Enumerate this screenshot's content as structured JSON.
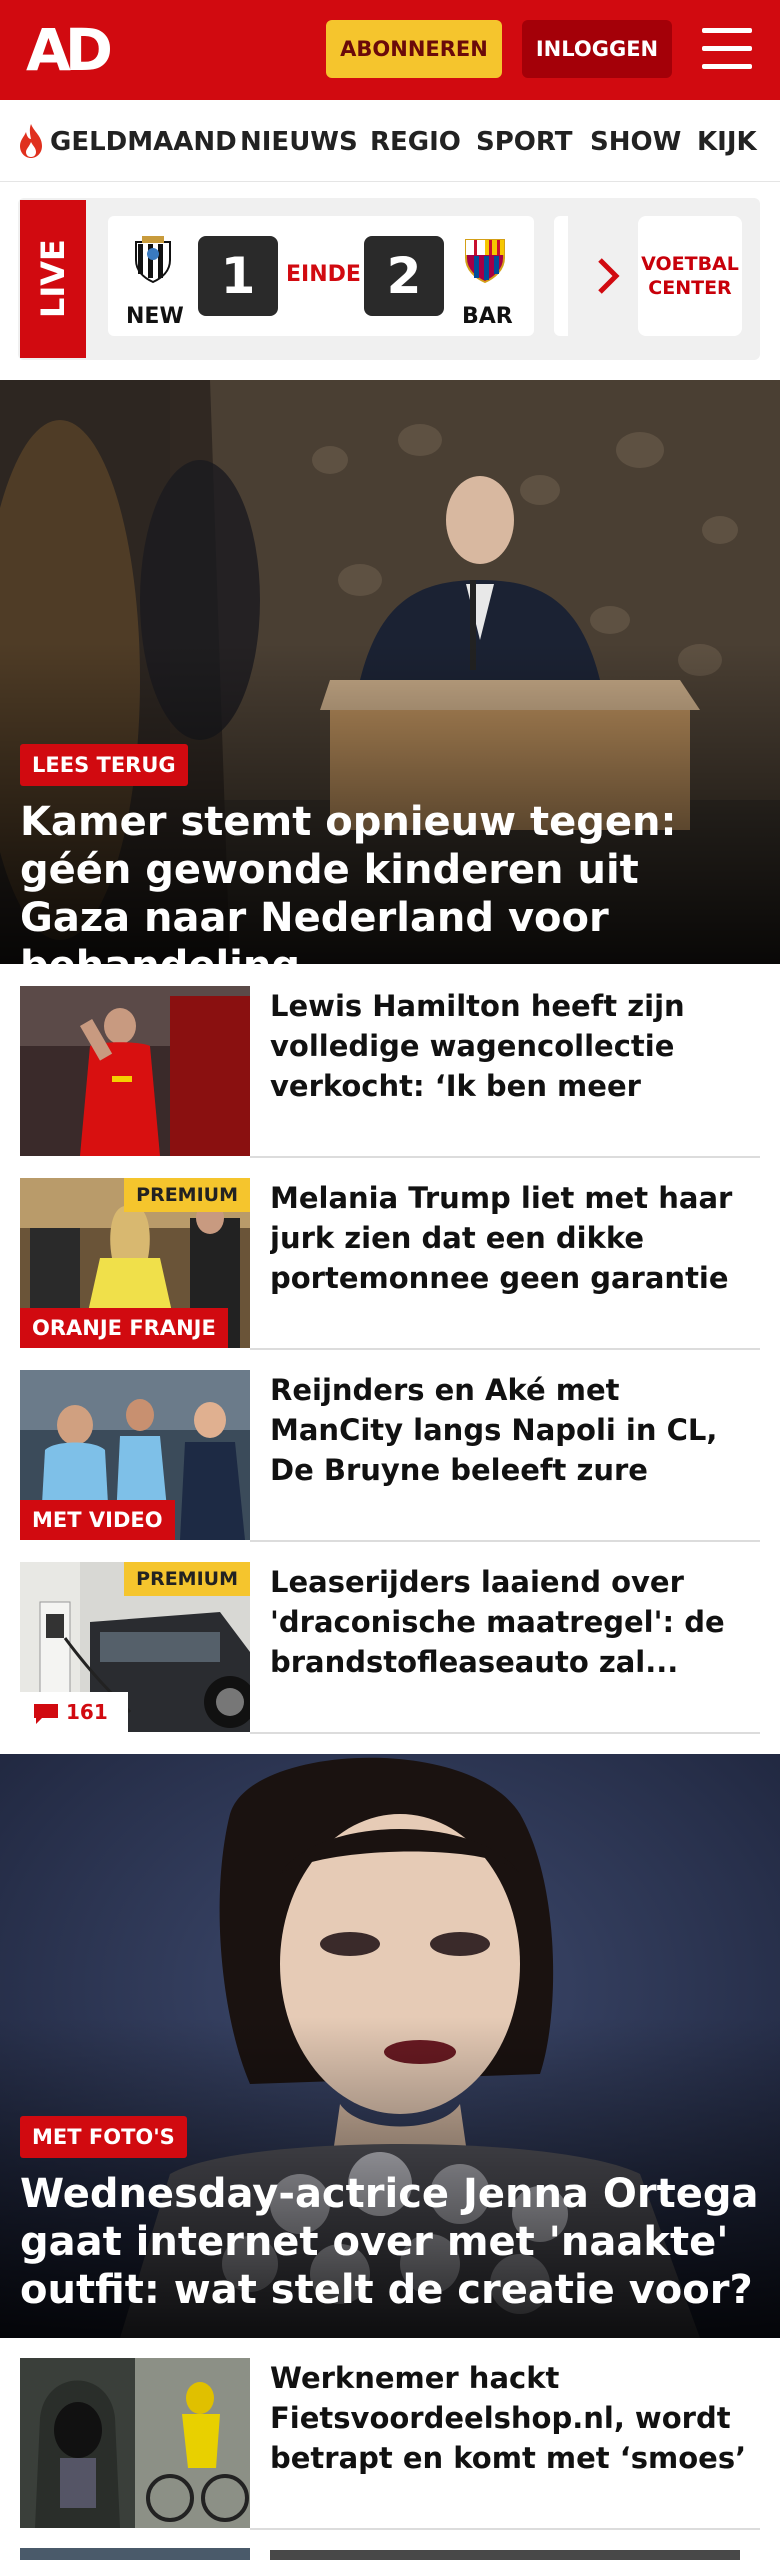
{
  "header": {
    "logo": "AD",
    "subscribe_label": "ABONNEREN",
    "login_label": "INLOGGEN"
  },
  "nav": {
    "items": [
      "GELDMAAND",
      "NIEUWS",
      "REGIO",
      "SPORT",
      "SHOW",
      "KIJK"
    ]
  },
  "live": {
    "tag": "LIVE",
    "home_team": "NEW",
    "away_team": "BAR",
    "home_score": "1",
    "away_score": "2",
    "status": "EINDE",
    "center_line1": "VOETBAL",
    "center_line2": "CENTER"
  },
  "hero1": {
    "label": "LEES TERUG",
    "title": "Kamer stemt opnieuw tegen: géén gewonde kinderen uit Gaza naar Nederland voor behandeling"
  },
  "articles": [
    {
      "title": "Lewis Hamilton heeft zijn volledige wagencollectie verkocht: ‘Ik ben meer geïntere...",
      "badge": "",
      "label": "",
      "comments": ""
    },
    {
      "title": "Melania Trump liet met haar jurk zien dat een dikke portemonnee geen garantie biedt voor...",
      "badge": "PREMIUM",
      "label": "ORANJE FRANJE",
      "comments": ""
    },
    {
      "title": "Reijnders en Aké met ManCity langs Napoli in CL, De Bruyne beleeft zure avond tegen zijn...",
      "badge": "",
      "label": "MET VIDEO",
      "comments": ""
    },
    {
      "title": "Leaserijders laaiend over 'draconische maatregel': de brandstofleaseauto zal...",
      "badge": "PREMIUM",
      "label": "",
      "comments": "161"
    }
  ],
  "hero2": {
    "label": "MET FOTO'S",
    "title": "Wednesday-actrice Jenna Ortega gaat internet over met 'naakte' outfit: wat stelt de creatie voor?"
  },
  "article5": {
    "title": "Werknemer hackt Fietsvoordeelshop.nl, wordt betrapt en komt met ‘smoes’ ov..."
  },
  "colors": {
    "brand_red": "#d10a10",
    "premium_yellow": "#f5c52d",
    "login_dark_red": "#a40008"
  }
}
